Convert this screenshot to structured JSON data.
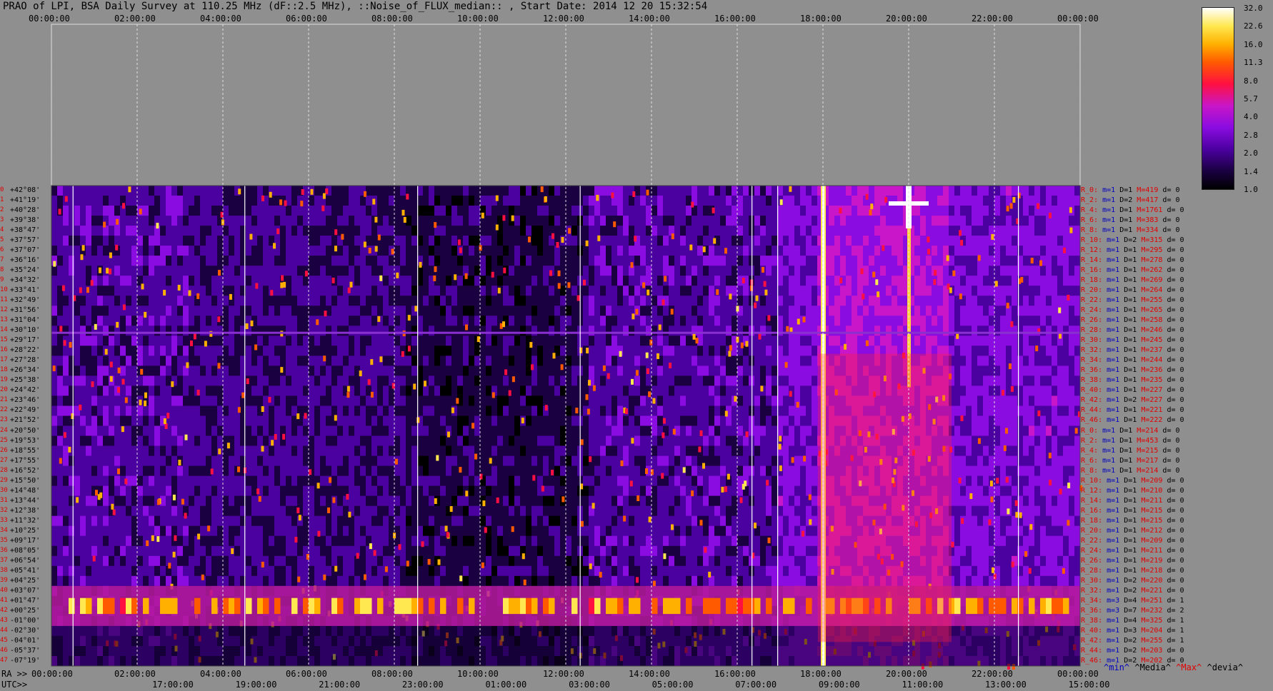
{
  "title": "PRAO of LPI, BSA Daily Survey at 110.25 MHz (dF::2.5 MHz), ::Noise_of_FLUX_median:: , Start Date: 2014 12 20 15:32:54",
  "chart_data": {
    "type": "heatmap",
    "x_top_ticks": [
      "00:00:00",
      "02:00:00",
      "04:00:00",
      "06:00:00",
      "08:00:00",
      "10:00:00",
      "12:00:00",
      "14:00:00",
      "16:00:00",
      "18:00:00",
      "20:00:00",
      "22:00:00",
      "00:00:00"
    ],
    "x_ra_label": "RA >>",
    "x_ra_ticks": [
      "00:00:00",
      "02:00:00",
      "04:00:00",
      "06:00:00",
      "08:00:00",
      "10:00:00",
      "12:00:00",
      "14:00:00",
      "16:00:00",
      "18:00:00",
      "20:00:00",
      "22:00:00",
      "00:00:00"
    ],
    "x_utc_label": "UTC>>",
    "x_utc_ticks": [
      "17:00:00",
      "19:00:00",
      "21:00:00",
      "23:00:00",
      "01:00:00",
      "03:00:00",
      "05:00:00",
      "07:00:00",
      "09:00:00",
      "11:00:00",
      "13:00:00",
      "15:00:00"
    ],
    "y_declinations": [
      "+42°08'",
      "+41°19'",
      "+40°28'",
      "+39°38'",
      "+38°47'",
      "+37°57'",
      "+37°07'",
      "+36°16'",
      "+35°24'",
      "+34°32'",
      "+33°41'",
      "+32°49'",
      "+31°56'",
      "+31°04'",
      "+30°10'",
      "+29°17'",
      "+28°22'",
      "+27°28'",
      "+26°34'",
      "+25°38'",
      "+24°42'",
      "+23°46'",
      "+22°49'",
      "+21°52'",
      "+20°50'",
      "+19°53'",
      "+18°55'",
      "+17°55'",
      "+16°52'",
      "+15°50'",
      "+14°48'",
      "+13°44'",
      "+12°38'",
      "+11°32'",
      "+10°25'",
      "+09°17'",
      "+08°05'",
      "+06°54'",
      "+05°41'",
      "+04°25'",
      "+03°07'",
      "+01°47'",
      "+00°25'",
      "-01°00'",
      "-02°30'",
      "-04°01'",
      "-05°37'",
      "-07°19'"
    ],
    "colorbar_ticks": [
      "32.0",
      "22.6",
      "16.0",
      "11.3",
      "8.0",
      "5.7",
      "4.0",
      "2.8",
      "2.0",
      "1.4",
      "1.0"
    ],
    "colorbar_colors": [
      "#000000",
      "#1a0040",
      "#4b00a0",
      "#8a0ce0",
      "#c816c8",
      "#ff1040",
      "#ff5a00",
      "#ffb000",
      "#ffe850",
      "#ffffff"
    ],
    "row_stats": [
      {
        "r": "R_0:",
        "m": "m=1",
        "D": "D=1",
        "M": "M=419",
        "d": "d= 0"
      },
      {
        "r": "R_2:",
        "m": "m=1",
        "D": "D=2",
        "M": "M=417",
        "d": "d= 0"
      },
      {
        "r": "R_4:",
        "m": "m=1",
        "D": "D=1",
        "M": "M=1761",
        "d": "d= 0"
      },
      {
        "r": "R_6:",
        "m": "m=1",
        "D": "D=1",
        "M": "M=383",
        "d": "d= 0"
      },
      {
        "r": "R_8:",
        "m": "m=1",
        "D": "D=1",
        "M": "M=334",
        "d": "d= 0"
      },
      {
        "r": "R_10:",
        "m": "m=1",
        "D": "D=2",
        "M": "M=315",
        "d": "d= 0"
      },
      {
        "r": "R_12:",
        "m": "m=1",
        "D": "D=1",
        "M": "M=295",
        "d": "d= 0"
      },
      {
        "r": "R_14:",
        "m": "m=1",
        "D": "D=1",
        "M": "M=278",
        "d": "d= 0"
      },
      {
        "r": "R_16:",
        "m": "m=1",
        "D": "D=1",
        "M": "M=262",
        "d": "d= 0"
      },
      {
        "r": "R_18:",
        "m": "m=1",
        "D": "D=1",
        "M": "M=269",
        "d": "d= 0"
      },
      {
        "r": "R_20:",
        "m": "m=1",
        "D": "D=1",
        "M": "M=264",
        "d": "d= 0"
      },
      {
        "r": "R_22:",
        "m": "m=1",
        "D": "D=1",
        "M": "M=255",
        "d": "d= 0"
      },
      {
        "r": "R_24:",
        "m": "m=1",
        "D": "D=1",
        "M": "M=265",
        "d": "d= 0"
      },
      {
        "r": "R_26:",
        "m": "m=1",
        "D": "D=1",
        "M": "M=258",
        "d": "d= 0"
      },
      {
        "r": "R_28:",
        "m": "m=1",
        "D": "D=1",
        "M": "M=246",
        "d": "d= 0"
      },
      {
        "r": "R_30:",
        "m": "m=1",
        "D": "D=1",
        "M": "M=245",
        "d": "d= 0"
      },
      {
        "r": "R_32:",
        "m": "m=1",
        "D": "D=1",
        "M": "M=237",
        "d": "d= 0"
      },
      {
        "r": "R_34:",
        "m": "m=1",
        "D": "D=1",
        "M": "M=244",
        "d": "d= 0"
      },
      {
        "r": "R_36:",
        "m": "m=1",
        "D": "D=1",
        "M": "M=236",
        "d": "d= 0"
      },
      {
        "r": "R_38:",
        "m": "m=1",
        "D": "D=1",
        "M": "M=235",
        "d": "d= 0"
      },
      {
        "r": "R_40:",
        "m": "m=1",
        "D": "D=1",
        "M": "M=227",
        "d": "d= 0"
      },
      {
        "r": "R_42:",
        "m": "m=1",
        "D": "D=2",
        "M": "M=227",
        "d": "d= 0"
      },
      {
        "r": "R_44:",
        "m": "m=1",
        "D": "D=1",
        "M": "M=221",
        "d": "d= 0"
      },
      {
        "r": "R_46:",
        "m": "m=1",
        "D": "D=1",
        "M": "M=222",
        "d": "d= 0"
      },
      {
        "r": "R_0:",
        "m": "m=1",
        "D": "D=1",
        "M": "M=214",
        "d": "d= 0"
      },
      {
        "r": "R_2:",
        "m": "m=1",
        "D": "D=1",
        "M": "M=453",
        "d": "d= 0"
      },
      {
        "r": "R_4:",
        "m": "m=1",
        "D": "D=1",
        "M": "M=215",
        "d": "d= 0"
      },
      {
        "r": "R_6:",
        "m": "m=1",
        "D": "D=1",
        "M": "M=217",
        "d": "d= 0"
      },
      {
        "r": "R_8:",
        "m": "m=1",
        "D": "D=1",
        "M": "M=214",
        "d": "d= 0"
      },
      {
        "r": "R_10:",
        "m": "m=1",
        "D": "D=1",
        "M": "M=209",
        "d": "d= 0"
      },
      {
        "r": "R_12:",
        "m": "m=1",
        "D": "D=1",
        "M": "M=210",
        "d": "d= 0"
      },
      {
        "r": "R_14:",
        "m": "m=1",
        "D": "D=1",
        "M": "M=211",
        "d": "d= 0"
      },
      {
        "r": "R_16:",
        "m": "m=1",
        "D": "D=1",
        "M": "M=215",
        "d": "d= 0"
      },
      {
        "r": "R_18:",
        "m": "m=1",
        "D": "D=1",
        "M": "M=215",
        "d": "d= 0"
      },
      {
        "r": "R_20:",
        "m": "m=1",
        "D": "D=1",
        "M": "M=212",
        "d": "d= 0"
      },
      {
        "r": "R_22:",
        "m": "m=1",
        "D": "D=1",
        "M": "M=209",
        "d": "d= 0"
      },
      {
        "r": "R_24:",
        "m": "m=1",
        "D": "D=1",
        "M": "M=211",
        "d": "d= 0"
      },
      {
        "r": "R_26:",
        "m": "m=1",
        "D": "D=1",
        "M": "M=219",
        "d": "d= 0"
      },
      {
        "r": "R_28:",
        "m": "m=1",
        "D": "D=1",
        "M": "M=218",
        "d": "d= 0"
      },
      {
        "r": "R_30:",
        "m": "m=1",
        "D": "D=2",
        "M": "M=220",
        "d": "d= 0"
      },
      {
        "r": "R_32:",
        "m": "m=1",
        "D": "D=2",
        "M": "M=221",
        "d": "d= 0"
      },
      {
        "r": "R_34:",
        "m": "m=3",
        "D": "D=4",
        "M": "M=251",
        "d": "d= 1"
      },
      {
        "r": "R_36:",
        "m": "m=3",
        "D": "D=7",
        "M": "M=232",
        "d": "d= 2"
      },
      {
        "r": "R_38:",
        "m": "m=1",
        "D": "D=4",
        "M": "M=325",
        "d": "d= 1"
      },
      {
        "r": "R_40:",
        "m": "m=1",
        "D": "D=3",
        "M": "M=204",
        "d": "d= 1"
      },
      {
        "r": "R_42:",
        "m": "m=1",
        "D": "D=2",
        "M": "M=255",
        "d": "d= 1"
      },
      {
        "r": "R_44:",
        "m": "m=1",
        "D": "D=2",
        "M": "M=203",
        "d": "d= 0"
      },
      {
        "r": "R_46:",
        "m": "m=1",
        "D": "D=2",
        "M": "M=202",
        "d": "d= 0"
      }
    ],
    "legend": [
      {
        "label": "^min^",
        "color": "#0000c0"
      },
      {
        "label": "^Media^",
        "color": "#000000"
      },
      {
        "label": "^Max^",
        "color": "#e00000"
      },
      {
        "label": "^devia^",
        "color": "#000000"
      }
    ]
  }
}
